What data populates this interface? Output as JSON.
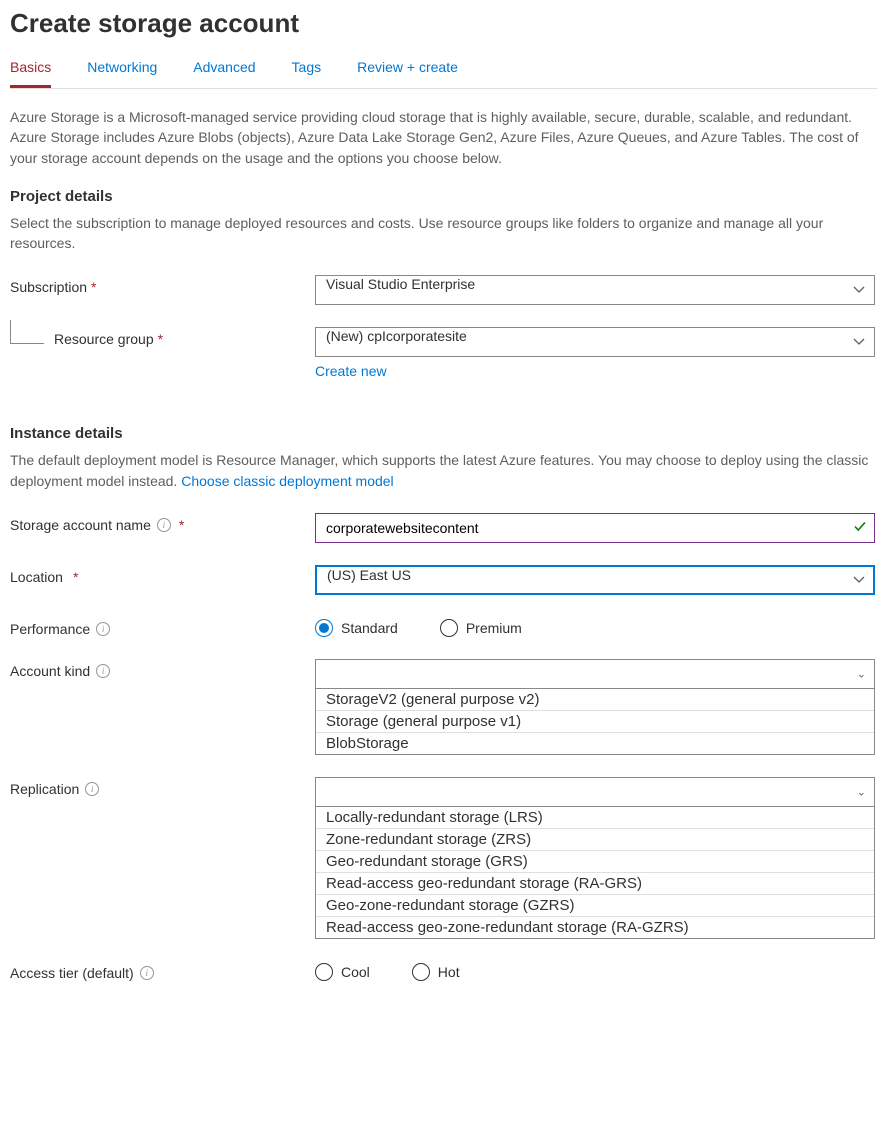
{
  "page_title": "Create storage account",
  "tabs": [
    "Basics",
    "Networking",
    "Advanced",
    "Tags",
    "Review + create"
  ],
  "intro": "Azure Storage is a Microsoft-managed service providing cloud storage that is highly available, secure, durable, scalable, and redundant. Azure Storage includes Azure Blobs (objects), Azure Data Lake Storage Gen2, Azure Files, Azure Queues, and Azure Tables. The cost of your storage account depends on the usage and the options you choose below.",
  "project": {
    "heading": "Project details",
    "desc": "Select the subscription to manage deployed resources and costs. Use resource groups like folders to organize and manage all your resources.",
    "subscription_label": "Subscription",
    "subscription_value": "Visual Studio Enterprise",
    "rg_label": "Resource group",
    "rg_value": "(New) cpIcorporatesite",
    "create_new": "Create new"
  },
  "instance": {
    "heading": "Instance details",
    "desc_a": "The default deployment model is Resource Manager, which supports the latest Azure features. You may choose to deploy using the classic deployment model instead.  ",
    "desc_link": "Choose classic deployment model",
    "name_label": "Storage account name",
    "name_value": "corporatewebsitecontent",
    "location_label": "Location",
    "location_value": "(US) East US",
    "performance_label": "Performance",
    "perf_options": [
      "Standard",
      "Premium"
    ],
    "kind_label": "Account kind",
    "kind_options": [
      "StorageV2 (general purpose v2)",
      "Storage (general purpose v1)",
      "BlobStorage"
    ],
    "replication_label": "Replication",
    "replication_options": [
      "Locally-redundant storage (LRS)",
      "Zone-redundant storage (ZRS)",
      "Geo-redundant storage (GRS)",
      "Read-access geo-redundant storage (RA-GRS)",
      "Geo-zone-redundant storage (GZRS)",
      "Read-access geo-zone-redundant storage (RA-GZRS)"
    ],
    "tier_label": "Access tier (default)",
    "tier_options": [
      "Cool",
      "Hot"
    ]
  }
}
